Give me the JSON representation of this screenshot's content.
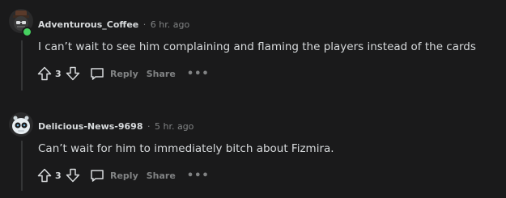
{
  "comments": [
    {
      "username": "Adventurous_Coffee",
      "separator": "·",
      "time": "6 hr. ago",
      "body": "I can’t wait to see him complaining and flaming the players instead of the cards",
      "score": "3",
      "reply_label": "Reply",
      "share_label": "Share",
      "more_label": "•••",
      "online": true
    },
    {
      "username": "Delicious-News-9698",
      "separator": "·",
      "time": "5 hr. ago",
      "body": "Can’t wait for him to immediately bitch about Fizmira.",
      "score": "3",
      "reply_label": "Reply",
      "share_label": "Share",
      "more_label": "•••",
      "online": false
    }
  ],
  "colors": {
    "background": "#1a1a1b",
    "text": "#d7dadc",
    "muted": "#818384",
    "online": "#46d160"
  }
}
